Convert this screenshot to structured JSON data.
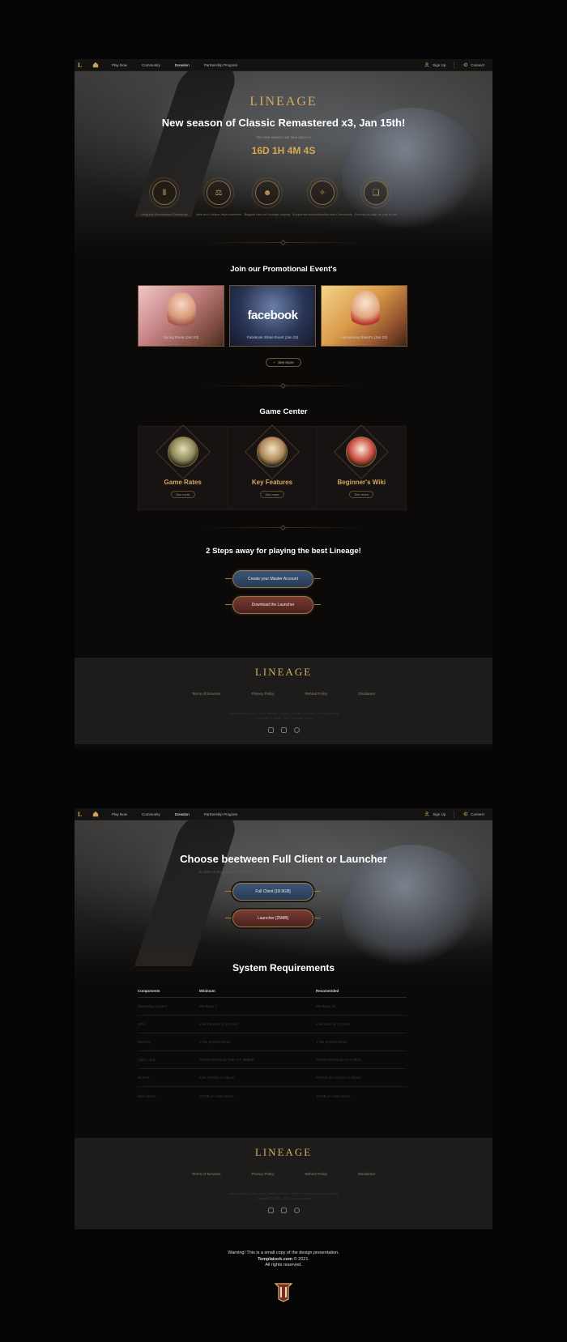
{
  "nav": {
    "logo": "L",
    "items": [
      {
        "label": "Play Now"
      },
      {
        "label": "Community"
      },
      {
        "label": "Donation"
      },
      {
        "label": "Partnership Program"
      }
    ],
    "signup": "Sign Up",
    "connect": "Connect"
  },
  "page1": {
    "brand": "LINEAGE",
    "headline": "New season of Classic Remastered x3, Jan 15th!",
    "season_note": "The new Season will take place in",
    "countdown": "16D 1H 4M 4S",
    "features": [
      {
        "icon": "pillar-icon",
        "text": "Uniquely Remastered Gameplay"
      },
      {
        "icon": "scales-icon",
        "text": "New and Unique Improvements"
      },
      {
        "icon": "people-icon",
        "text": "Biggest Hero of Lineage playing"
      },
      {
        "icon": "support-icon",
        "text": "Supportive Administration and Community"
      },
      {
        "icon": "book-icon",
        "text": "Friendly to play, no pay to win"
      }
    ],
    "events_title": "Join our Promotional Event's",
    "events": [
      {
        "caption": "Spring Event (Jan 23)"
      },
      {
        "caption": "Facebook Share Event (Jan 23)",
        "overlay": "facebook"
      },
      {
        "caption": "Anniversary Event's (Jan 23)"
      }
    ],
    "see_more": "See more",
    "game_center_title": "Game Center",
    "game_center": [
      {
        "title": "Game Rates",
        "button": "See more"
      },
      {
        "title": "Key Features",
        "button": "See more"
      },
      {
        "title": "Beginner's Wiki",
        "button": "See more"
      }
    ],
    "steps_title": "2 Steps away for playing the best Lineage!",
    "create_account": "Create your Master Account",
    "download_launcher": "Download the Launcher"
  },
  "footer": {
    "brand": "LINEAGE",
    "links": [
      "Terms of Services",
      "Privacy Policy",
      "Refund Policy",
      "Disclaimer"
    ],
    "copy_line1": "Game Rates | Lore | Key Features | Rules | Terms of Service | Privacy Policy",
    "copy_line2": "Copyright © 1998 - 2021 Lineage Team",
    "social": [
      "instagram-icon",
      "discord-icon",
      "facebook-icon"
    ]
  },
  "page2": {
    "headline": "Choose beetween Full Client or Launcher",
    "sub": "In case of any problem with the launcher, please download the full client and follow the instructions below",
    "full_client": "Full Client [18.9GB]",
    "launcher": "Launcher [25MB]",
    "requirements_title": "System Requirements",
    "columns": [
      "Components",
      "Minimum",
      "Recomended"
    ],
    "rows": [
      [
        "Operating System",
        "Windows 7",
        "Windows 10"
      ],
      [
        "CPU",
        "Intel Pentium 4 3.6 GHz",
        "Intel Core i5 3.2 GHz"
      ],
      [
        "Memory",
        "2 GB System RAM",
        "4 GB System RAM"
      ],
      [
        "Video card",
        "NVIDIA GeForce 7600 GT 256MB",
        "NVIDIA GeForce GTX 1050"
      ],
      [
        "DirectX",
        "9.0c Version or above",
        "DirectX 11 Version or above"
      ],
      [
        "Disk Space",
        "20 GB or more space",
        "30 GB or more space"
      ]
    ]
  },
  "warning": {
    "line1": "Warning! This is a small copy of the design presentation.",
    "site": "Templatock.com",
    "year": " © 2021.",
    "line3": "All rights reserved."
  },
  "colors": {
    "accent_gold": "#d8a94f",
    "button_blue": "#3c5677",
    "button_red": "#773b33",
    "background": "#050505"
  }
}
